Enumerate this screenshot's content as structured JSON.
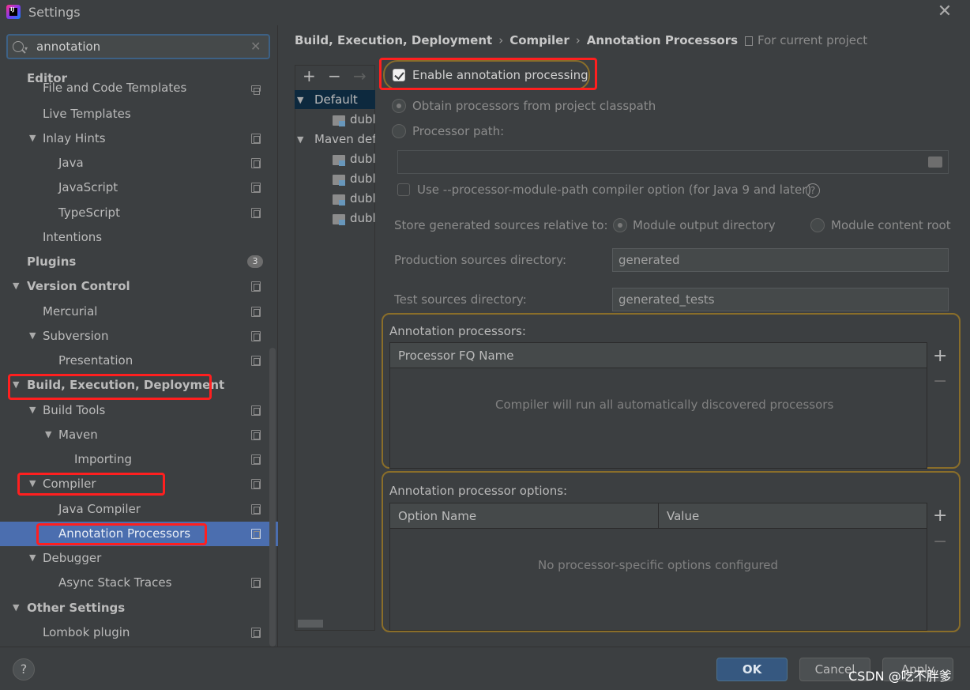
{
  "window": {
    "title": "Settings"
  },
  "search": {
    "value": "annotation"
  },
  "sidebar": {
    "partial_item": "File and Code Templates",
    "items": [
      {
        "label": "Editor"
      },
      {
        "label": "Live Templates"
      },
      {
        "label": "Inlay Hints"
      },
      {
        "label": "Java"
      },
      {
        "label": "JavaScript"
      },
      {
        "label": "TypeScript"
      },
      {
        "label": "Intentions"
      },
      {
        "label": "Plugins",
        "badge": "3"
      },
      {
        "label": "Version Control"
      },
      {
        "label": "Mercurial"
      },
      {
        "label": "Subversion"
      },
      {
        "label": "Presentation"
      },
      {
        "label": "Build, Execution, Deployment"
      },
      {
        "label": "Build Tools"
      },
      {
        "label": "Maven"
      },
      {
        "label": "Importing"
      },
      {
        "label": "Compiler"
      },
      {
        "label": "Java Compiler"
      },
      {
        "label": "Annotation Processors"
      },
      {
        "label": "Debugger"
      },
      {
        "label": "Async Stack Traces"
      },
      {
        "label": "Other Settings"
      },
      {
        "label": "Lombok plugin"
      }
    ]
  },
  "breadcrumb": {
    "items": [
      "Build, Execution, Deployment",
      "Compiler",
      "Annotation Processors"
    ],
    "separator": "›",
    "scope": "For current project"
  },
  "profiles": {
    "toolbar": [
      "+",
      "−",
      "→"
    ],
    "rows": [
      "Default",
      "dubl",
      "Maven def",
      "dubl",
      "dubl",
      "dubl",
      "dubl"
    ]
  },
  "settings": {
    "enable_label": "Enable annotation processing",
    "obtain_label": "Obtain processors from project classpath",
    "processor_path_label": "Processor path:",
    "module_path_label": "Use --processor-module-path compiler option (for Java 9 and later)",
    "help_glyph": "?",
    "store_label": "Store generated sources relative to:",
    "module_output_label": "Module output directory",
    "module_content_label": "Module content root",
    "production_label": "Production sources directory:",
    "production_value": "generated",
    "test_label": "Test sources directory:",
    "test_value": "generated_tests"
  },
  "processors": {
    "title": "Annotation processors:",
    "column": "Processor FQ Name",
    "empty": "Compiler will run all automatically discovered processors",
    "add": "+",
    "remove": "−"
  },
  "options": {
    "title": "Annotation processor options:",
    "columns": [
      "Option Name",
      "Value"
    ],
    "empty": "No processor-specific options configured",
    "add": "+",
    "remove": "−"
  },
  "footer": {
    "help": "?",
    "ok": "OK",
    "cancel": "Cancel",
    "apply": "Apply",
    "watermark": "CSDN @吃不胖爹"
  },
  "colors": {
    "background": "#3c3f41",
    "selection": "#4b6eaf",
    "ok_button": "#365880",
    "highlight_red": "#ff1f1f",
    "highlight_gold": "#8a6e2a"
  }
}
